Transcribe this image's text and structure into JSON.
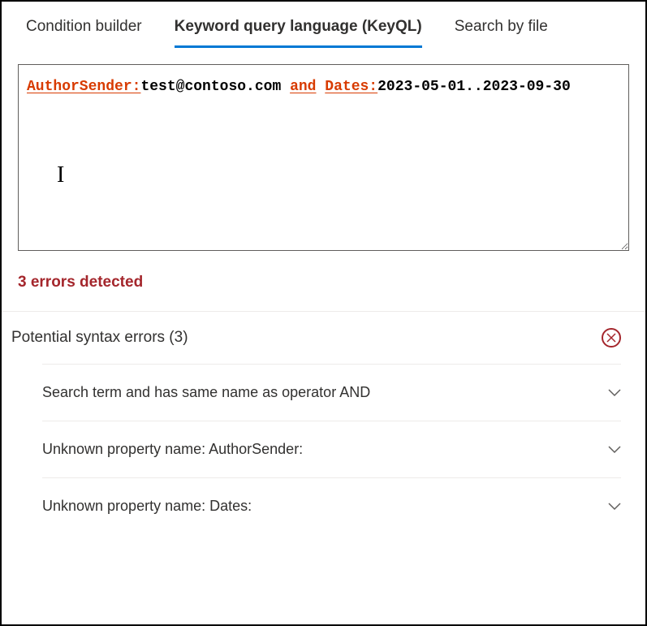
{
  "tabs": [
    {
      "label": "Condition builder",
      "active": false
    },
    {
      "label": "Keyword query language (KeyQL)",
      "active": true
    },
    {
      "label": "Search by file",
      "active": false
    }
  ],
  "query": {
    "token1_prop": "AuthorSender:",
    "token1_val": "test@contoso.com",
    "token_op": "and",
    "token2_prop": "Dates:",
    "token2_val": "2023-05-01..2023-09-30"
  },
  "error_summary": "3 errors detected",
  "syntax_section": {
    "title": "Potential syntax errors (3)"
  },
  "errors": [
    {
      "text": "Search term and has same name as operator AND"
    },
    {
      "text": "Unknown property name: AuthorSender:"
    },
    {
      "text": "Unknown property name: Dates:"
    }
  ]
}
